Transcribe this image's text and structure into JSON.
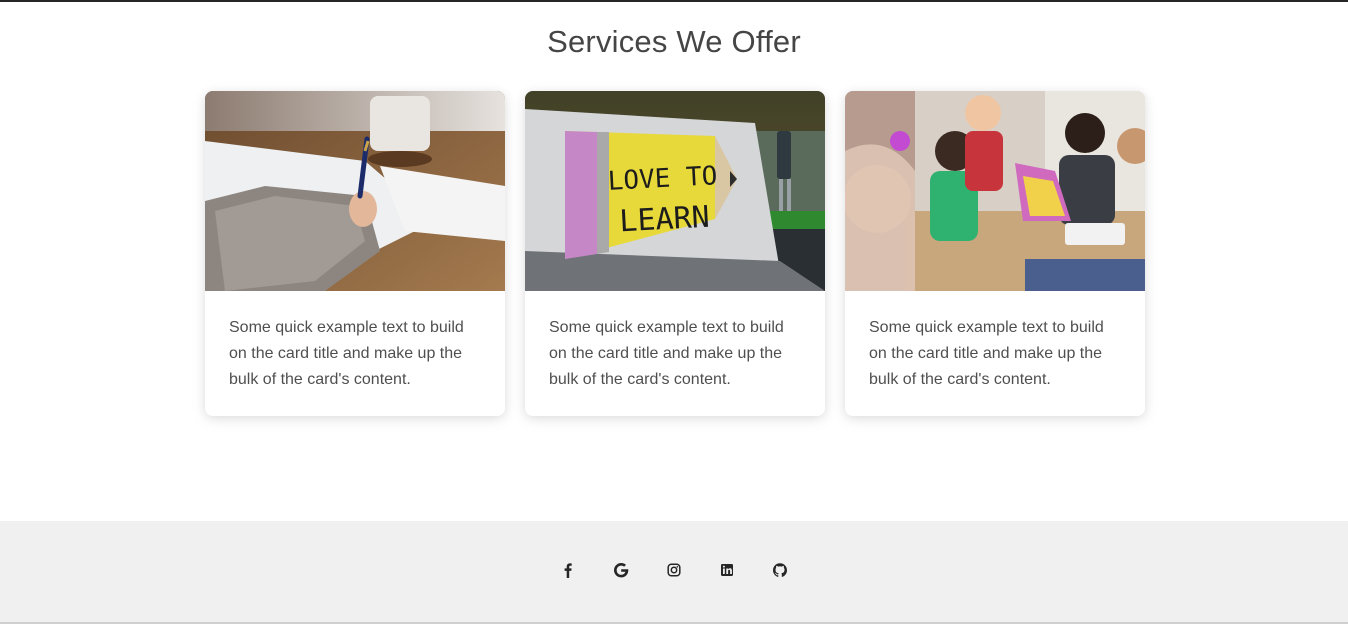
{
  "services": {
    "title": "Services We Offer",
    "cards": [
      {
        "text": "Some quick example text to build on the card title and make up the bulk of the card's content.",
        "image": "writing-notes-photo"
      },
      {
        "text": "Some quick example text to build on the card title and make up the bulk of the card's content.",
        "image": "love-to-learn-sign-photo",
        "image_text": "LOVE TO LEARN"
      },
      {
        "text": "Some quick example text to build on the card title and make up the bulk of the card's content.",
        "image": "kids-reading-photo"
      }
    ]
  },
  "footer": {
    "social_icons": [
      "facebook-icon",
      "google-icon",
      "instagram-icon",
      "linkedin-icon",
      "github-icon"
    ],
    "background_color": "#f0f0f0"
  }
}
